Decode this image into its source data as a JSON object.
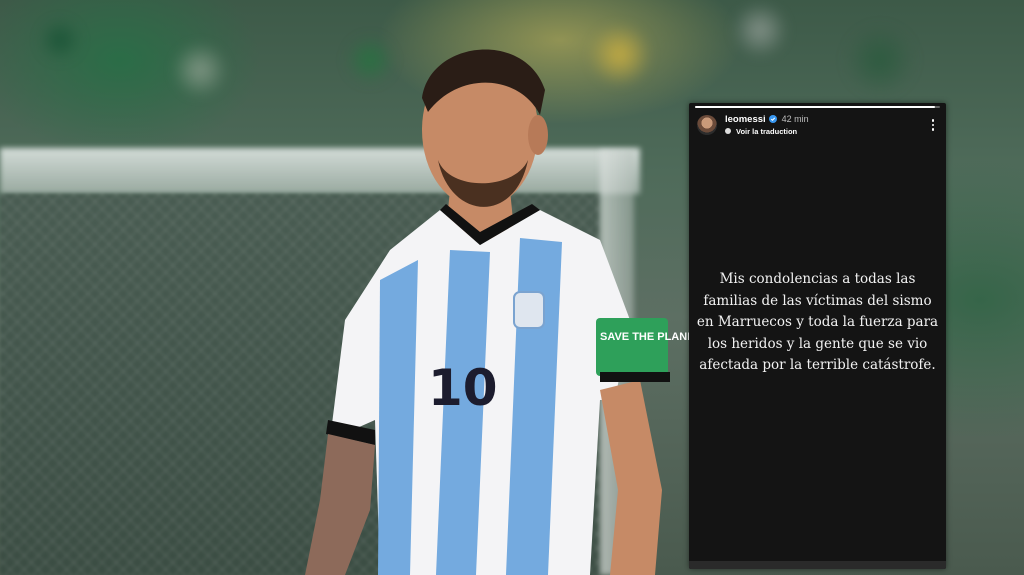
{
  "story": {
    "username": "leomessi",
    "time": "42 min",
    "translate_label": "Voir la traduction",
    "progress": 0.98,
    "text": "Mis condolencias a todas las familias de las víctimas del sismo en Marruecos y toda la fuerza para los heridos y la gente que se vio afectada por la terrible catástrofe."
  },
  "jersey": {
    "number": "10",
    "armband": "SAVE THE PLANET"
  },
  "icons": {
    "verified": "verified-badge-icon",
    "more": "more-options-icon",
    "translate": "globe-icon"
  },
  "colors": {
    "panel": "#141414",
    "jersey_blue": "#6fa8dc",
    "armband": "#2ea05a"
  }
}
